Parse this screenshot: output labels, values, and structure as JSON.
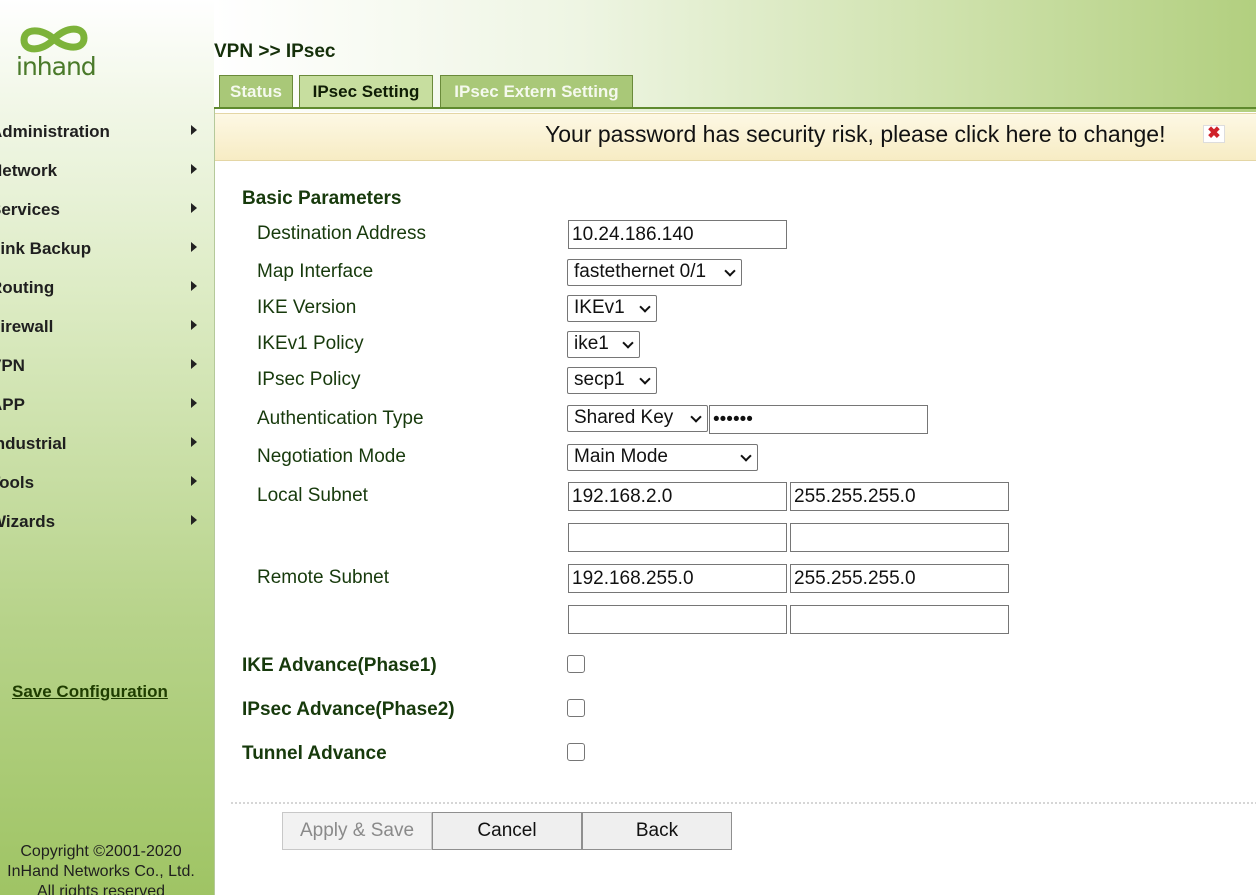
{
  "brand": {
    "logo_text": "inhand"
  },
  "sidebar": {
    "items": [
      {
        "label": "Administration",
        "name": "administration"
      },
      {
        "label": "Network",
        "name": "network"
      },
      {
        "label": "Services",
        "name": "services"
      },
      {
        "label": "Link Backup",
        "name": "link-backup"
      },
      {
        "label": "Routing",
        "name": "routing"
      },
      {
        "label": "Firewall",
        "name": "firewall"
      },
      {
        "label": "VPN",
        "name": "vpn"
      },
      {
        "label": "APP",
        "name": "app"
      },
      {
        "label": "Industrial",
        "name": "industrial"
      },
      {
        "label": "Tools",
        "name": "tools"
      },
      {
        "label": "Wizards",
        "name": "wizards"
      }
    ],
    "save_label": "Save Configuration",
    "copyright": [
      "Copyright ©2001-2020",
      "InHand Networks Co., Ltd.",
      "All rights reserved"
    ]
  },
  "header": {
    "breadcrumb": "VPN >> IPsec",
    "tabs": [
      {
        "label": "Status",
        "active": false
      },
      {
        "label": "IPsec Setting",
        "active": true
      },
      {
        "label": "IPsec Extern Setting",
        "active": false
      }
    ]
  },
  "warning": {
    "text": "Your password has security risk, please click here to change!",
    "close_glyph": "✖"
  },
  "form": {
    "section_title": "Basic Parameters",
    "labels": {
      "destination": "Destination Address",
      "map_interface": "Map Interface",
      "ike_version": "IKE Version",
      "ikev1_policy": "IKEv1 Policy",
      "ipsec_policy": "IPsec Policy",
      "auth_type": "Authentication Type",
      "negotiation": "Negotiation Mode",
      "local_subnet": "Local Subnet",
      "remote_subnet": "Remote Subnet"
    },
    "values": {
      "destination": "10.24.186.140",
      "map_interface": "fastethernet 0/1",
      "ike_version": "IKEv1",
      "ikev1_policy": "ike1",
      "ipsec_policy": "secp1",
      "auth_type": "Shared Key",
      "shared_key": "••••••",
      "negotiation": "Main Mode",
      "local_subnet_1_ip": "192.168.2.0",
      "local_subnet_1_mask": "255.255.255.0",
      "local_subnet_2_ip": "",
      "local_subnet_2_mask": "",
      "remote_subnet_1_ip": "192.168.255.0",
      "remote_subnet_1_mask": "255.255.255.0",
      "remote_subnet_2_ip": "",
      "remote_subnet_2_mask": ""
    },
    "advanced": {
      "ike_phase1": {
        "label": "IKE Advance(Phase1)",
        "checked": false
      },
      "ipsec_phase2": {
        "label": "IPsec Advance(Phase2)",
        "checked": false
      },
      "tunnel": {
        "label": "Tunnel Advance",
        "checked": false
      }
    }
  },
  "buttons": {
    "apply_save": "Apply & Save",
    "cancel": "Cancel",
    "back": "Back"
  },
  "colors": {
    "accent_green": "#5f8a2e",
    "tab_inactive": "#a9c878",
    "tab_active": "#c7de9f",
    "label_text": "#173a0c",
    "warning_bg": "#f7ecc4",
    "close_red": "#d0222a"
  }
}
